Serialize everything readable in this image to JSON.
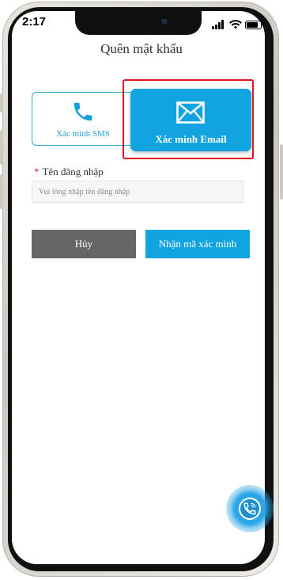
{
  "status_bar": {
    "time": "2:17"
  },
  "page": {
    "title": "Quên mật khẩu"
  },
  "methods": {
    "sms_label": "Xác minh SMS",
    "email_label": "Xác minh Email",
    "sms_icon": "phone-icon",
    "email_icon": "envelope-icon"
  },
  "form": {
    "username_label": "Tên đăng nhập",
    "required_mark": "*",
    "username_placeholder": "Vui lòng nhập tên đăng nhập",
    "username_value": ""
  },
  "buttons": {
    "cancel_label": "Hủy",
    "get_code_label": "Nhận mã xác minh"
  },
  "colors": {
    "accent": "#11a4e0",
    "cancel": "#666666",
    "highlight": "#e0151f"
  },
  "fab": {
    "icon": "call-support-icon"
  }
}
